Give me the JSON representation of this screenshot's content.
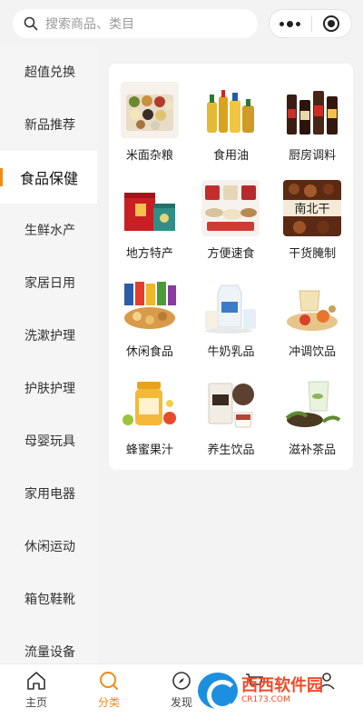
{
  "search": {
    "placeholder": "搜索商品、类目",
    "icon": "search-icon"
  },
  "capsule": {
    "menu_icon": "more-dots-icon",
    "close_icon": "target-circle-icon"
  },
  "sidebar": {
    "active_color": "#f18a16",
    "items": [
      {
        "label": "超值兑换",
        "active": false
      },
      {
        "label": "新品推荐",
        "active": false
      },
      {
        "label": "食品保健",
        "active": true
      },
      {
        "label": "生鲜水产",
        "active": false
      },
      {
        "label": "家居日用",
        "active": false
      },
      {
        "label": "洗漱护理",
        "active": false
      },
      {
        "label": "护肤护理",
        "active": false
      },
      {
        "label": "母婴玩具",
        "active": false
      },
      {
        "label": "家用电器",
        "active": false
      },
      {
        "label": "休闲运动",
        "active": false
      },
      {
        "label": "箱包鞋靴",
        "active": false
      },
      {
        "label": "流量设备",
        "active": false
      }
    ]
  },
  "categories": [
    {
      "label": "米面杂粮",
      "icon": "grains-image"
    },
    {
      "label": "食用油",
      "icon": "cooking-oil-image"
    },
    {
      "label": "厨房调料",
      "icon": "seasoning-bottles-image"
    },
    {
      "label": "地方特产",
      "icon": "gift-box-image"
    },
    {
      "label": "方便速食",
      "icon": "instant-food-image"
    },
    {
      "label": "干货腌制",
      "icon": "dried-goods-image"
    },
    {
      "label": "休闲食品",
      "icon": "snacks-image"
    },
    {
      "label": "牛奶乳品",
      "icon": "milk-image"
    },
    {
      "label": "冲调饮品",
      "icon": "drink-image"
    },
    {
      "label": "蜂蜜果汁",
      "icon": "honey-image"
    },
    {
      "label": "养生饮品",
      "icon": "health-drink-image"
    },
    {
      "label": "滋补茶品",
      "icon": "tea-image"
    }
  ],
  "tabbar": {
    "items": [
      {
        "label": "主页",
        "icon": "home-icon",
        "active": false
      },
      {
        "label": "分类",
        "icon": "category-icon",
        "active": true
      },
      {
        "label": "发现",
        "icon": "discover-icon",
        "active": false
      },
      {
        "label": "",
        "icon": "cart-icon",
        "active": false
      },
      {
        "label": "",
        "icon": "profile-icon",
        "active": false
      }
    ]
  },
  "watermark": {
    "brand": "西西软件园",
    "url": "CR173.COM"
  }
}
